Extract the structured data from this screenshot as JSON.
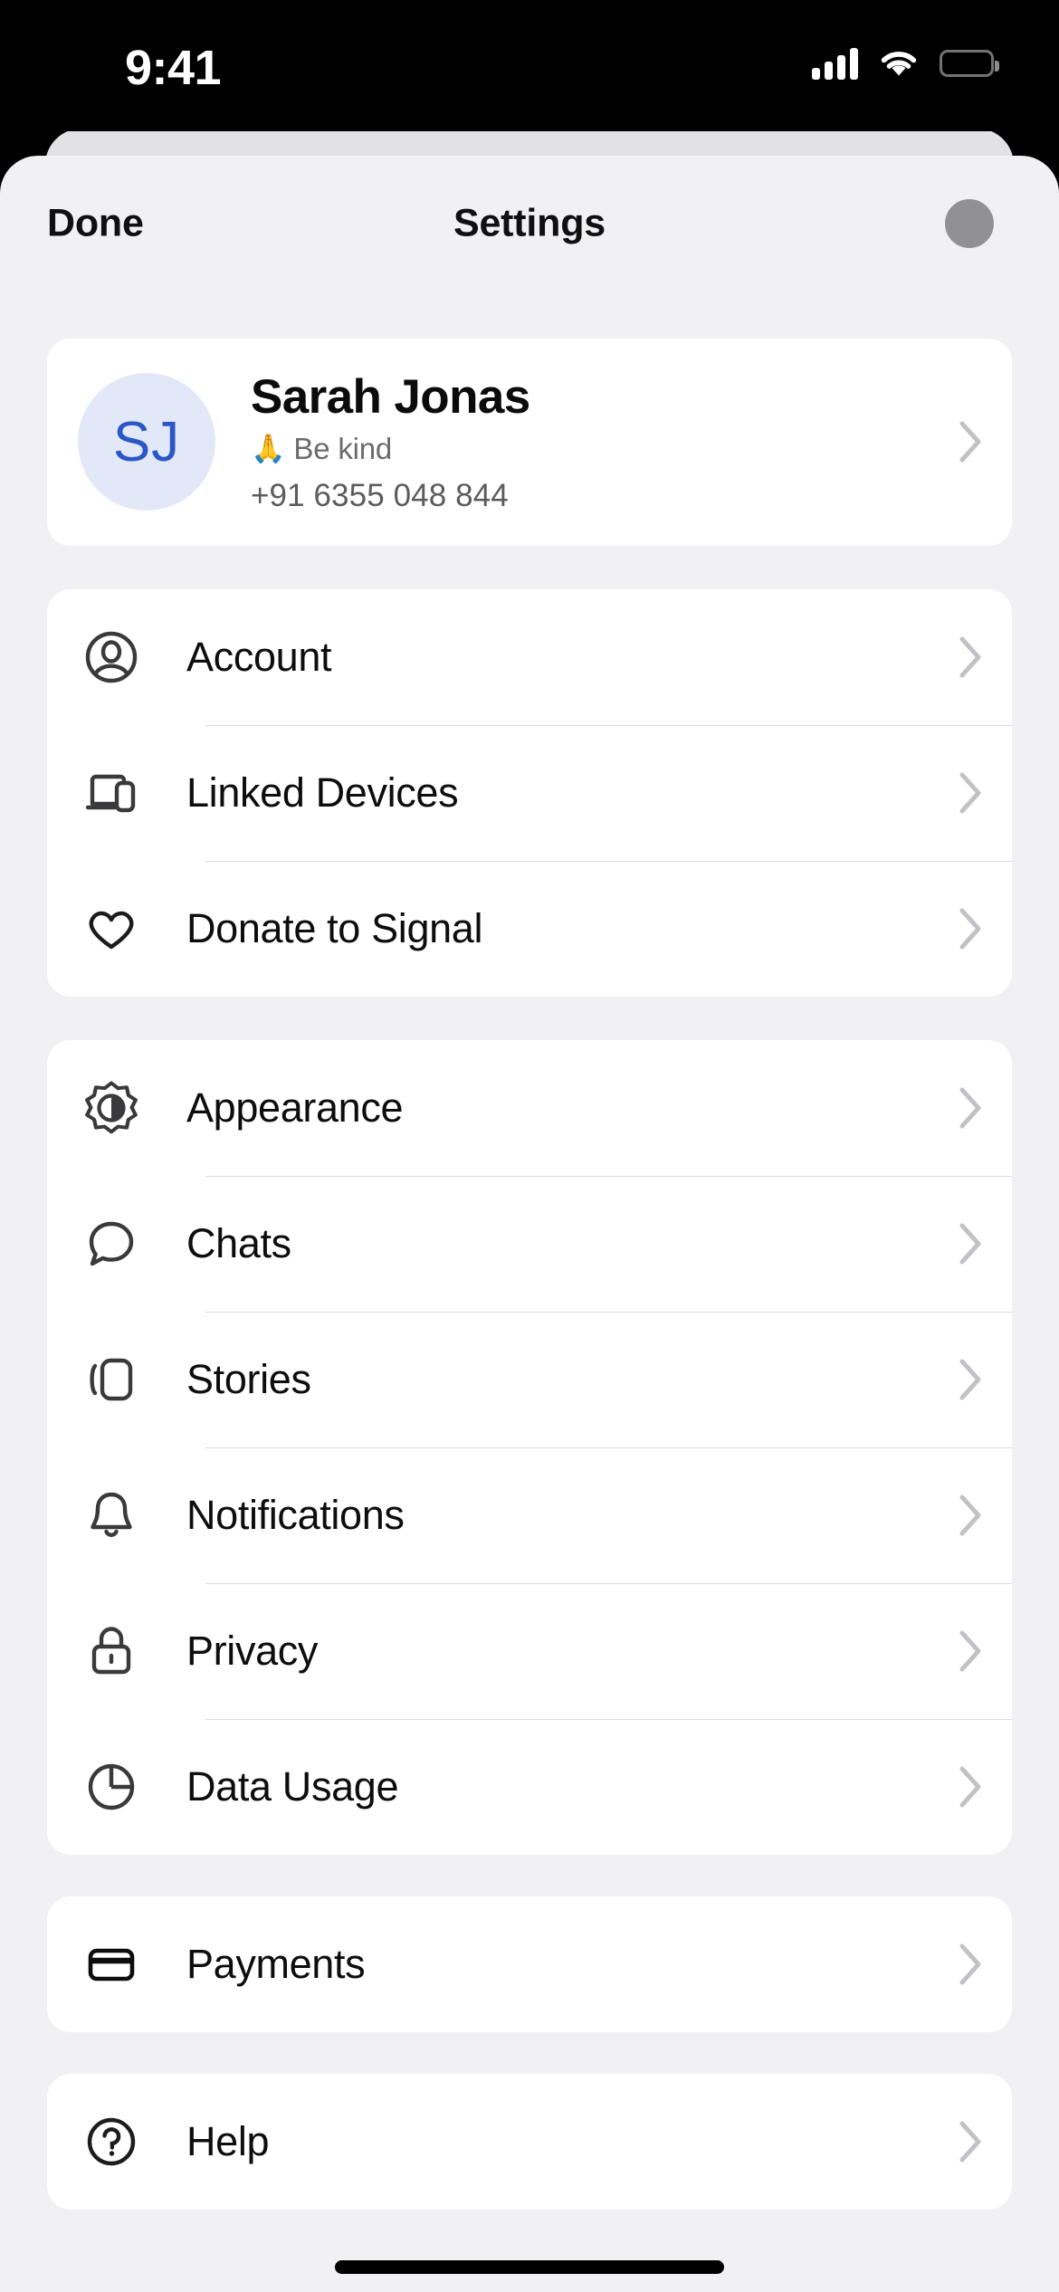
{
  "status_bar": {
    "time": "9:41",
    "cellular_icon": "cellular-signal-icon",
    "wifi_icon": "wifi-icon",
    "battery_icon": "battery-full-icon"
  },
  "nav": {
    "done_label": "Done",
    "title": "Settings",
    "avatar_icon": "profile-avatar-icon",
    "avatar_color": "#919195"
  },
  "profile": {
    "initials": "SJ",
    "name": "Sarah Jonas",
    "about_emoji": "🙏",
    "about_text": "Be kind",
    "phone": "+91 6355 048 844",
    "avatar_bg": "#E2E8F8",
    "avatar_fg": "#2A56C6",
    "chevron_icon": "chevron-right-icon"
  },
  "groups": [
    {
      "id": "account-group",
      "items": [
        {
          "id": "account",
          "label": "Account",
          "icon": "person-circle-icon"
        },
        {
          "id": "linked-devices",
          "label": "Linked Devices",
          "icon": "devices-icon"
        },
        {
          "id": "donate-to-signal",
          "label": "Donate to Signal",
          "icon": "heart-icon"
        }
      ]
    },
    {
      "id": "preferences-group",
      "items": [
        {
          "id": "appearance",
          "label": "Appearance",
          "icon": "brightness-icon"
        },
        {
          "id": "chats",
          "label": "Chats",
          "icon": "chat-bubble-icon"
        },
        {
          "id": "stories",
          "label": "Stories",
          "icon": "stories-card-icon"
        },
        {
          "id": "notifications",
          "label": "Notifications",
          "icon": "bell-icon"
        },
        {
          "id": "privacy",
          "label": "Privacy",
          "icon": "lock-icon"
        },
        {
          "id": "data-usage",
          "label": "Data Usage",
          "icon": "pie-chart-icon"
        }
      ]
    },
    {
      "id": "payments-group",
      "items": [
        {
          "id": "payments",
          "label": "Payments",
          "icon": "credit-card-icon"
        }
      ]
    },
    {
      "id": "help-group",
      "items": [
        {
          "id": "help",
          "label": "Help",
          "icon": "question-circle-icon"
        }
      ]
    }
  ],
  "home_indicator": {
    "icon": "home-indicator-bar"
  },
  "colors": {
    "sheet_bg": "#F1F1F4",
    "card_bg": "#FFFFFF",
    "separator": "#DDDDDF",
    "text_primary": "#0D0D0E",
    "text_secondary": "#6C6C70",
    "chevron": "#C2C2C6",
    "accent_blue": "#2A56C6"
  }
}
